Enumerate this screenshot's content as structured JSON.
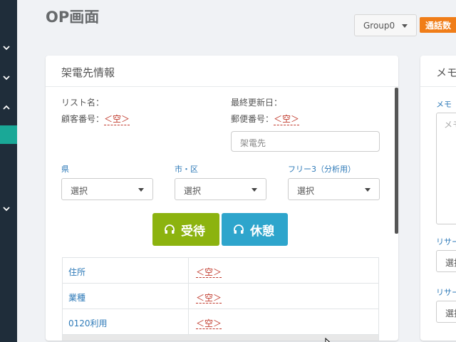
{
  "page": {
    "title": "OP画面"
  },
  "header": {
    "group_select": "Group0",
    "calls_badge": "通話数"
  },
  "callee": {
    "title": "架電先情報",
    "list_name_label": "リスト名：",
    "last_updated_label": "最終更新日：",
    "customer_no_label": "顧客番号：",
    "customer_no_value": "＜空＞",
    "postal_label": "郵便番号：",
    "postal_value": "＜空＞",
    "callee_placeholder": "架電先",
    "filters": [
      {
        "label": "県",
        "value": "選択"
      },
      {
        "label": "市・区",
        "value": "選択"
      },
      {
        "label": "フリー3（分析用）",
        "value": "選択"
      }
    ],
    "accept_button": "受待",
    "break_button": "休憩",
    "rows": [
      {
        "key": "住所",
        "value": "＜空＞"
      },
      {
        "key": "業種",
        "value": "＜空＞"
      },
      {
        "key": "0120利用",
        "value": "＜空＞"
      }
    ]
  },
  "memo": {
    "title": "メモ",
    "label": "メモ",
    "placeholder": "メモ",
    "research1_label": "リサーチ",
    "research1_value": "選択",
    "research2_label": "リサーチ",
    "research2_value": "選択"
  },
  "colors": {
    "accept": "#8cb30f",
    "break": "#2ea5cc",
    "sidebar": "#1f2d3a",
    "active": "#1aa897",
    "badge": "#f07d18"
  }
}
